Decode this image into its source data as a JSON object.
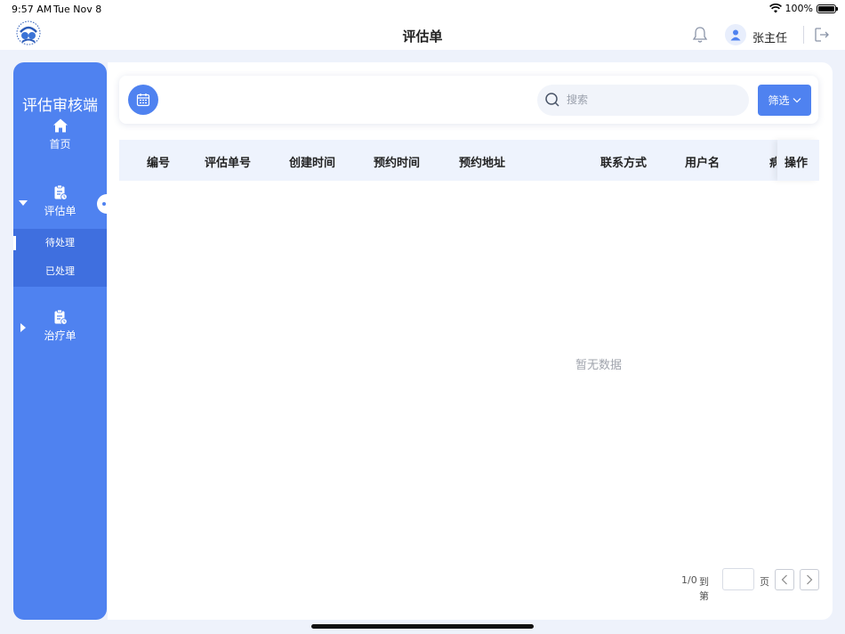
{
  "status_bar": {
    "time": "9:57 AM",
    "date": "Tue Nov 8",
    "battery": "100%",
    "wifi_icon": "wifi-icon",
    "battery_icon": "battery-icon"
  },
  "header": {
    "title": "评估单",
    "user_name": "张主任",
    "icons": [
      "logo-icon",
      "bell-icon",
      "user-avatar-icon",
      "logout-icon"
    ]
  },
  "sidebar": {
    "brand": "评估审核端",
    "items": [
      {
        "label": "首页",
        "icon": "home-icon"
      },
      {
        "label": "评估单",
        "icon": "clipboard-icon",
        "expanded": true,
        "children": [
          {
            "label": "待处理",
            "active": true
          },
          {
            "label": "已处理",
            "active": false
          }
        ]
      },
      {
        "label": "治疗单",
        "icon": "clipboard-icon",
        "expanded": false
      }
    ]
  },
  "toolbar": {
    "calendar_icon": "calendar-icon",
    "search_placeholder": "搜索",
    "search_value": "",
    "filter_label": "筛选",
    "filter_icon": "chevron-down-icon"
  },
  "table": {
    "columns": [
      "编号",
      "评估单号",
      "创建时间",
      "预约时间",
      "预约地址",
      "联系方式",
      "用户名",
      "病",
      "操作"
    ],
    "rows": [],
    "empty_text": "暂无数据"
  },
  "pagination": {
    "count": "1/0",
    "goto_label": "到第",
    "page_value": "",
    "page_unit": "页"
  },
  "colors": {
    "primary": "#4f82f0",
    "submenu_bg": "#3f6fdf",
    "table_header_bg": "#eef3fd",
    "page_bg": "#eef2fb"
  }
}
